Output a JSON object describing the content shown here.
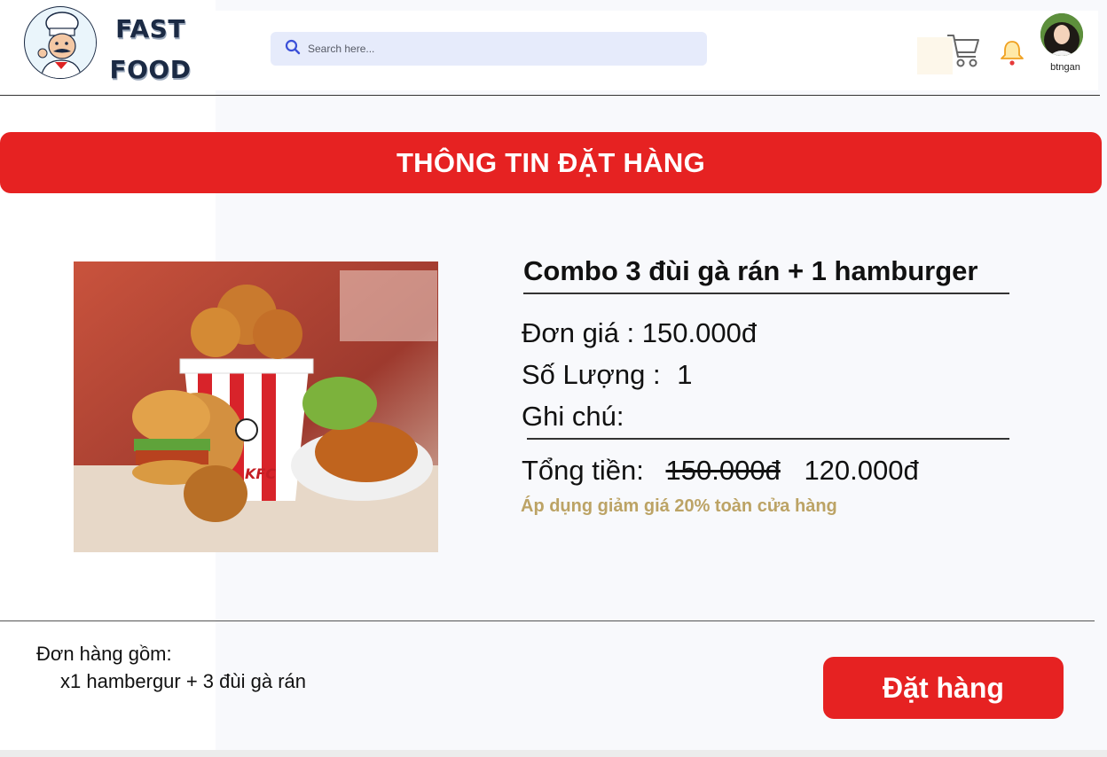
{
  "header": {
    "logo_line1": "FAST",
    "logo_line2": "FOOD",
    "search_placeholder": "Search here...",
    "username": "btngan",
    "icons": [
      "chef-logo",
      "search-icon",
      "cart-icon",
      "bell-icon",
      "avatar"
    ]
  },
  "banner": {
    "title": "THÔNG TIN ĐẶT HÀNG"
  },
  "product": {
    "title": "Combo 3 đùi gà rán + 1 hamburger",
    "unit_price_label": "Đơn giá :",
    "unit_price": "150.000đ",
    "quantity_label": "Số Lượng :",
    "quantity": "1",
    "note_label": "Ghi chú:",
    "total_label": "Tổng tiền:",
    "old_total": "150.000đ",
    "new_total": "120.000đ",
    "discount_note": "Áp dụng giảm giá 20% toàn cửa hàng"
  },
  "order": {
    "summary_label": "Đơn hàng gồm:",
    "summary_item": "x1 hambergur + 3 đùi gà rán",
    "submit_label": "Đặt hàng"
  },
  "colors": {
    "accent": "#e62222",
    "discount": "#bca365",
    "search_bg": "#e6ebfb",
    "logo_text": "#1b2a44"
  }
}
